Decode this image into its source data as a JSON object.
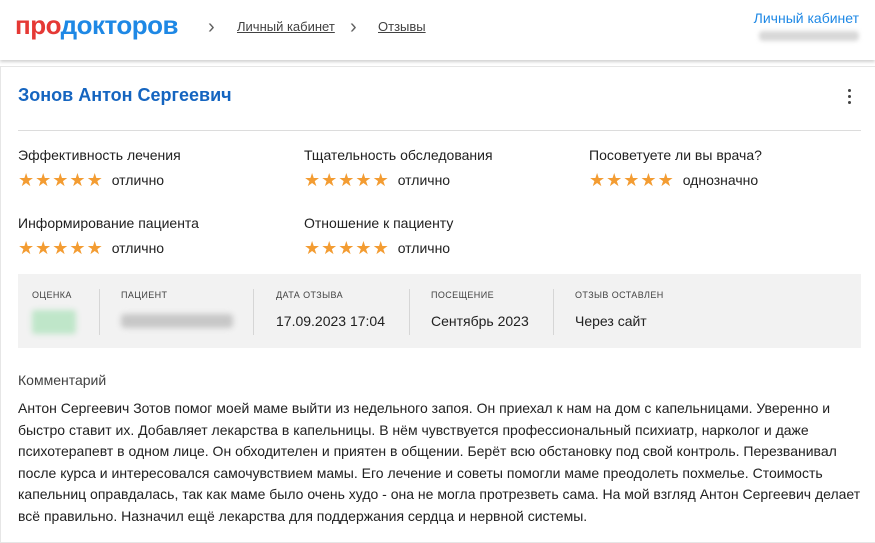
{
  "header": {
    "logo_part1": "про",
    "logo_part2": "докторов",
    "breadcrumbs": [
      "Личный кабинет",
      "Отзывы"
    ],
    "cabinet_link": "Личный кабинет"
  },
  "review": {
    "doctor_name": "Зонов Антон Сергеевич",
    "ratings": [
      {
        "label": "Эффективность лечения",
        "stars": 5,
        "value": "отлично"
      },
      {
        "label": "Тщательность обследования",
        "stars": 5,
        "value": "отлично"
      },
      {
        "label": "Посоветуете ли вы врача?",
        "stars": 5,
        "value": "однозначно"
      },
      {
        "label": "Информирование пациента",
        "stars": 5,
        "value": "отлично"
      },
      {
        "label": "Отношение к пациенту",
        "stars": 5,
        "value": "отлично"
      }
    ],
    "info": {
      "score_label": "Оценка",
      "patient_label": "Пациент",
      "date_label": "Дата отзыва",
      "date_value": "17.09.2023 17:04",
      "visit_label": "Посещение",
      "visit_value": "Сентябрь 2023",
      "source_label": "Отзыв оставлен",
      "source_value": "Через сайт"
    },
    "comment_title": "Комментарий",
    "comment_text": "Антон Сергеевич Зотов помог моей маме выйти из недельного запоя. Он приехал к нам на дом с капельницами. Уверенно и быстро ставит их. Добавляет лекарства в капельницы. В нём чувствуется профессиональный психиатр, нарколог и даже психотерапевт в одном лице. Он обходителен и приятен в общении. Берёт всю обстановку под свой контроль. Перезванивал после курса и интересовался самочувствием мамы. Его лечение и советы помогли маме преодолеть похмелье. Стоимость капельниц оправдалась, так как маме было очень худо - она не могла протрезветь сама. На мой взгляд Антон Сергеевич делает всё правильно. Назначил ещё лекарства для поддержания сердца и нервной системы."
  },
  "colors": {
    "accent_blue": "#1e88e5",
    "brand_red": "#e53935",
    "star": "#f39c32"
  }
}
